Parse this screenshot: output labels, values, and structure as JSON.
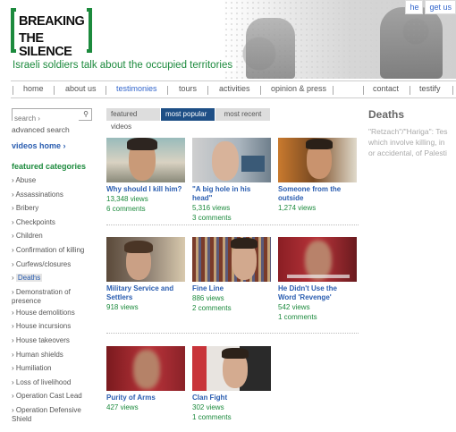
{
  "header": {
    "logo_line1": "BREAKING",
    "logo_line2": "THE SILENCE",
    "tagline": "Israeli soldiers talk about the occupied territories",
    "lang_link": "he",
    "contact_link": "get us"
  },
  "nav": {
    "items": [
      "home",
      "about us",
      "testimonies",
      "tours",
      "activities",
      "opinion & press",
      "contact",
      "testify"
    ],
    "active": "testimonies"
  },
  "sidebar": {
    "search_placeholder": "search ›",
    "advanced_search": "advanced search",
    "videos_home": "videos home ›",
    "categories_title": "featured categories",
    "categories": [
      "Abuse",
      "Assassinations",
      "Bribery",
      "Checkpoints",
      "Children",
      "Confirmation of killing",
      "Curfews/closures",
      "Deaths",
      "Demonstration of presence",
      "House demolitions",
      "House incursions",
      "House takeovers",
      "Human shields",
      "Humiliation",
      "Loss of livelihood",
      "Operation Cast Lead",
      "Operation Defensive Shield"
    ],
    "active_category": "Deaths"
  },
  "tabs": [
    "featured videos",
    "most popular",
    "most recent"
  ],
  "active_tab": "most popular",
  "videos": [
    {
      "title": "Why should I kill him?",
      "views": "13,348 views",
      "comments": "6 comments"
    },
    {
      "title": "\"A big hole in his head\"",
      "views": "5,316 views",
      "comments": "3 comments"
    },
    {
      "title": "Someone from the outside",
      "views": "1,274 views",
      "comments": ""
    },
    {
      "title": "Military Service and Settlers",
      "views": "918 views",
      "comments": ""
    },
    {
      "title": "Fine Line",
      "views": "886 views",
      "comments": "2 comments"
    },
    {
      "title": "He Didn't Use the Word 'Revenge'",
      "views": "542 views",
      "comments": "1 comments"
    },
    {
      "title": "Purity of Arms",
      "views": "427 views",
      "comments": ""
    },
    {
      "title": "Clan Fight",
      "views": "302 views",
      "comments": "1 comments"
    }
  ],
  "category_panel": {
    "heading": "Deaths",
    "description_lines": [
      "\"Retzach\"/\"Hariga\": Tes",
      "which involve killing, in",
      "or accidental, of Palesti"
    ]
  },
  "colors": {
    "brand_green": "#1c8a3d",
    "link_blue": "#2a5db0",
    "active_tab": "#1e4f86"
  }
}
